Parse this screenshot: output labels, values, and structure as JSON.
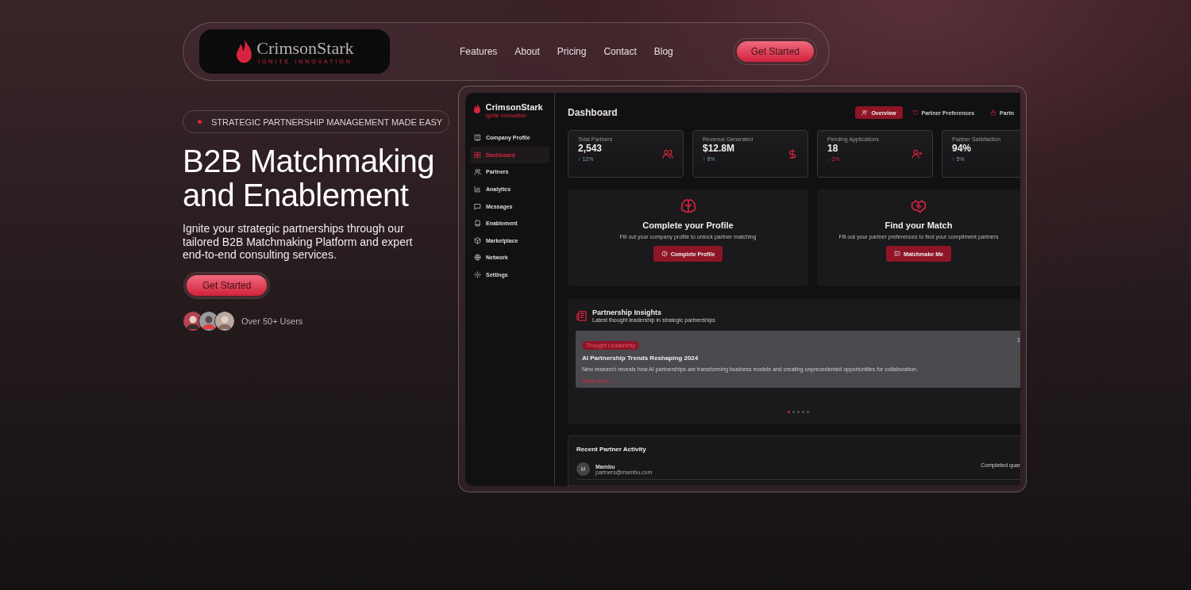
{
  "nav": {
    "logo": {
      "name": "CrimsonStark",
      "tagline": "IGNITE INNOVATION"
    },
    "links": [
      "Features",
      "About",
      "Pricing",
      "Contact",
      "Blog"
    ],
    "cta": "Get Started"
  },
  "hero": {
    "badge": "STRATEGIC PARTNERSHIP MANAGEMENT MADE EASY",
    "heading": "B2B Matchmaking and Enablement",
    "description": "Ignite your strategic partnerships through our tailored B2B Matchmaking Platform and expert end-to-end consulting services.",
    "cta": "Get Started",
    "users": "Over 50+ Users"
  },
  "dashboard": {
    "brand": {
      "name": "CrimsonStark",
      "tagline": "Ignite Innovation"
    },
    "sidebar": [
      {
        "label": "Company Profile",
        "selected": false
      },
      {
        "label": "Dashboard",
        "selected": true
      },
      {
        "label": "Partners",
        "selected": false
      },
      {
        "label": "Analytics",
        "selected": false
      },
      {
        "label": "Messages",
        "selected": false
      },
      {
        "label": "Enablement",
        "selected": false
      },
      {
        "label": "Marketplace",
        "selected": false
      },
      {
        "label": "Network",
        "selected": false
      },
      {
        "label": "Settings",
        "selected": false
      }
    ],
    "title": "Dashboard",
    "tabs": [
      {
        "label": "Overview",
        "selected": true
      },
      {
        "label": "Partner Preferences",
        "selected": false
      },
      {
        "label": "Partn",
        "selected": false
      }
    ],
    "stats": [
      {
        "label": "Total Partners",
        "value": "2,543",
        "change": "↑ 12%",
        "negative": false
      },
      {
        "label": "Revenue Generated",
        "value": "$12.8M",
        "change": "↑ 8%",
        "negative": false
      },
      {
        "label": "Pending Applications",
        "value": "18",
        "change": "↓ 2%",
        "negative": true
      },
      {
        "label": "Partner Satisfaction",
        "value": "94%",
        "change": "↑ 5%",
        "negative": false
      }
    ],
    "actions": [
      {
        "title": "Complete your Profile",
        "text": "Fill out your company profile to unlock partner matching",
        "button": "Complete Profile"
      },
      {
        "title": "Find your Match",
        "text": "Fill out your partner preferences to find your compliment partners",
        "button": "Matchmake Me"
      }
    ],
    "insights": {
      "title": "Partnership Insights",
      "subtitle": "Latest thought leadership in strategic partnerships",
      "article": {
        "tag": "Thought Leadership",
        "date": "1",
        "title": "AI Partnership Trends Reshaping 2024",
        "text": "New research reveals how AI partnerships are transforming business models and creating unprecedented opportunities for collaboration.",
        "link": "Read more →"
      },
      "dots": [
        {
          "selected": true
        },
        {
          "selected": false
        },
        {
          "selected": false
        },
        {
          "selected": false
        },
        {
          "selected": false
        }
      ]
    },
    "activity": {
      "title": "Recent Partner Activity",
      "rows": [
        {
          "initial": "M",
          "name": "Mambu",
          "email": "partners@mambu.com",
          "status": "Completed quar"
        }
      ]
    }
  }
}
